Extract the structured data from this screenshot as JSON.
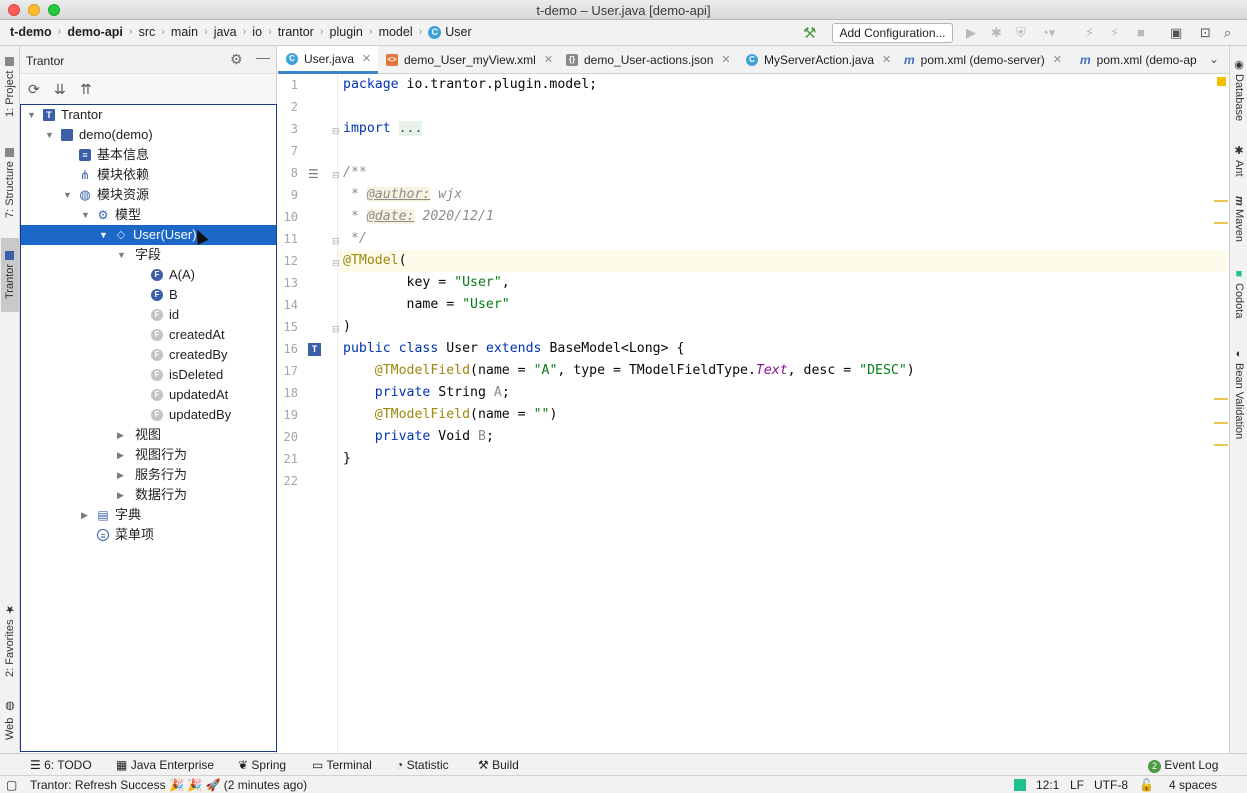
{
  "window": {
    "title": "t-demo – User.java [demo-api]"
  },
  "breadcrumbs": [
    "t-demo",
    "demo-api",
    "src",
    "main",
    "java",
    "io",
    "trantor",
    "plugin",
    "model",
    "User"
  ],
  "toolbar": {
    "add_configuration": "Add Configuration..."
  },
  "left_stripe": {
    "project": "1: Project",
    "structure": "7: Structure",
    "trantor": "Trantor",
    "favorites": "2: Favorites",
    "web": "Web"
  },
  "right_stripe": {
    "database": "Database",
    "ant": "Ant",
    "maven": "Maven",
    "codota": "Codota",
    "bean_validation": "Bean Validation"
  },
  "panel": {
    "title": "Trantor",
    "tree": [
      {
        "label": "Trantor",
        "level": 0,
        "arrow": "down",
        "icon": "trantor-icon"
      },
      {
        "label": "demo(demo)",
        "level": 1,
        "arrow": "down",
        "icon": "folder-icon"
      },
      {
        "label": "基本信息",
        "level": 2,
        "arrow": "",
        "icon": "info-icon"
      },
      {
        "label": "模块依赖",
        "level": 2,
        "arrow": "",
        "icon": "hierarchy-icon"
      },
      {
        "label": "模块资源",
        "level": 2,
        "arrow": "down",
        "icon": "globe-icon"
      },
      {
        "label": "模型",
        "level": 3,
        "arrow": "down",
        "icon": "model-icon"
      },
      {
        "label": "User(User)",
        "level": 4,
        "arrow": "down",
        "icon": "entity-icon",
        "selected": true
      },
      {
        "label": "字段",
        "level": 5,
        "arrow": "down",
        "icon": ""
      },
      {
        "label": "A(A)",
        "level": 6,
        "arrow": "",
        "icon": "field-public-icon"
      },
      {
        "label": "B",
        "level": 6,
        "arrow": "",
        "icon": "field-public-icon"
      },
      {
        "label": "id",
        "level": 6,
        "arrow": "",
        "icon": "field-gray-icon"
      },
      {
        "label": "createdAt",
        "level": 6,
        "arrow": "",
        "icon": "field-gray-icon"
      },
      {
        "label": "createdBy",
        "level": 6,
        "arrow": "",
        "icon": "field-gray-icon"
      },
      {
        "label": "isDeleted",
        "level": 6,
        "arrow": "",
        "icon": "field-gray-icon"
      },
      {
        "label": "updatedAt",
        "level": 6,
        "arrow": "",
        "icon": "field-gray-icon"
      },
      {
        "label": "updatedBy",
        "level": 6,
        "arrow": "",
        "icon": "field-gray-icon"
      },
      {
        "label": "视图",
        "level": 5,
        "arrow": "right",
        "icon": ""
      },
      {
        "label": "视图行为",
        "level": 5,
        "arrow": "right",
        "icon": ""
      },
      {
        "label": "服务行为",
        "level": 5,
        "arrow": "right",
        "icon": ""
      },
      {
        "label": "数据行为",
        "level": 5,
        "arrow": "right",
        "icon": ""
      },
      {
        "label": "字典",
        "level": 3,
        "arrow": "right",
        "icon": "dictionary-icon"
      },
      {
        "label": "菜单项",
        "level": 3,
        "arrow": "",
        "icon": "menu-icon"
      }
    ]
  },
  "tabs": [
    {
      "label": "User.java",
      "active": true,
      "icon": "class-icon",
      "closable": true
    },
    {
      "label": "demo_User_myView.xml",
      "icon": "xml-icon",
      "closable": true
    },
    {
      "label": "demo_User-actions.json",
      "icon": "json-icon",
      "closable": true
    },
    {
      "label": "MyServerAction.java",
      "icon": "class-icon",
      "closable": true
    },
    {
      "label": "pom.xml (demo-server)",
      "icon": "maven-icon",
      "closable": true
    },
    {
      "label": "pom.xml (demo-ap",
      "icon": "maven-icon",
      "closable": false
    }
  ],
  "editor": {
    "line_numbers": [
      "1",
      "2",
      "3",
      "7",
      "8",
      "9",
      "10",
      "11",
      "12",
      "13",
      "14",
      "15",
      "16",
      "17",
      "18",
      "19",
      "20",
      "21",
      "22"
    ],
    "lines": {
      "l1_kw": "package",
      "l1_rest": " io.trantor.plugin.model;",
      "l3_kw": "import",
      "l3_fold": "...",
      "l8": "/**",
      "l9_pre": " * ",
      "l9_tag": "@author:",
      "l9_val": " wjx",
      "l10_pre": " * ",
      "l10_tag": "@date:",
      "l10_val": " 2020/12/1",
      "l11": " */",
      "l12_ann": "@TModel",
      "l12_rest": "(",
      "l13_key": "        key = ",
      "l13_val": "\"User\"",
      "l13_end": ",",
      "l14_key": "        name = ",
      "l14_val": "\"User\"",
      "l15": ")",
      "l16_kw1": "public class",
      "l16_mid": " User ",
      "l16_kw2": "extends",
      "l16_rest": " BaseModel<Long> {",
      "l17_ann": "    @TModelField",
      "l17_a": "(name = ",
      "l17_s1": "\"A\"",
      "l17_b": ", type = TModelFieldType.",
      "l17_it": "Text",
      "l17_c": ", desc = ",
      "l17_s2": "\"DESC\"",
      "l17_d": ")",
      "l18_kw": "    private",
      "l18_mid": " String ",
      "l18_var": "A",
      "l18_end": ";",
      "l19_ann": "    @TModelField",
      "l19_a": "(name = ",
      "l19_s": "\"\"",
      "l19_b": ")",
      "l20_kw": "    private",
      "l20_mid": " Void ",
      "l20_var": "B",
      "l20_end": ";",
      "l21": "}"
    }
  },
  "bottom_tools": [
    "6: TODO",
    "Java Enterprise",
    "Spring",
    "Terminal",
    "Statistic",
    "Build"
  ],
  "event_log": {
    "count": "2",
    "label": "Event Log"
  },
  "status": {
    "message": "Trantor: Refresh Success 🎉 🎉 🚀 (2 minutes ago)",
    "position": "12:1",
    "line_sep": "LF",
    "encoding": "UTF-8",
    "indent": "4 spaces"
  },
  "colors": {
    "selection": "#1b68c9",
    "accent": "#4083c9"
  }
}
